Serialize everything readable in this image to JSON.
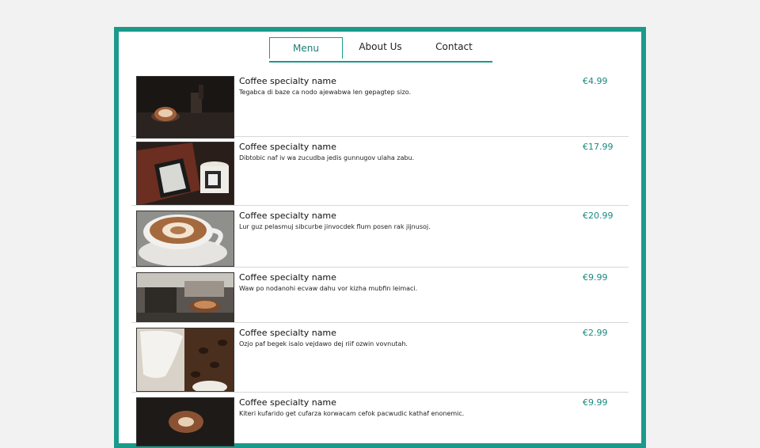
{
  "nav": {
    "tabs": [
      {
        "label": "Menu"
      },
      {
        "label": "About Us"
      },
      {
        "label": "Contact"
      }
    ],
    "accent": "#1a9a8a"
  },
  "menu": {
    "items": [
      {
        "name": "Coffee specialty name",
        "description": "Tegabca di baze ca nodo ajewabwa len gepagtep sizo.",
        "price": "€4.99",
        "image": "latte-on-dark-table"
      },
      {
        "name": "Coffee specialty name",
        "description": "Dibtobic naf iv wa zucudba jedis gunnugov ulaha zabu.",
        "price": "€17.99",
        "image": "ereader-and-mug"
      },
      {
        "name": "Coffee specialty name",
        "description": "Lur guz pelasmuj sibcurbe jinvocdek flum posen rak jijnusoj.",
        "price": "€20.99",
        "image": "latte-art-cup"
      },
      {
        "name": "Coffee specialty name",
        "description": "Waw po nodanohi ecvaw dahu vor kizha mubfin leimaci.",
        "price": "€9.99",
        "image": "espresso-machine"
      },
      {
        "name": "Coffee specialty name",
        "description": "Ozjo paf begek isalo vejdawo dej riif ozwin vovnutah.",
        "price": "€2.99",
        "image": "milk-jug-and-beans"
      },
      {
        "name": "Coffee specialty name",
        "description": "Kiteri kufarido get cufarza korwacam cefok pacwudic kathaf enonemic.",
        "price": "€9.99",
        "image": "latte-top-view"
      }
    ]
  }
}
